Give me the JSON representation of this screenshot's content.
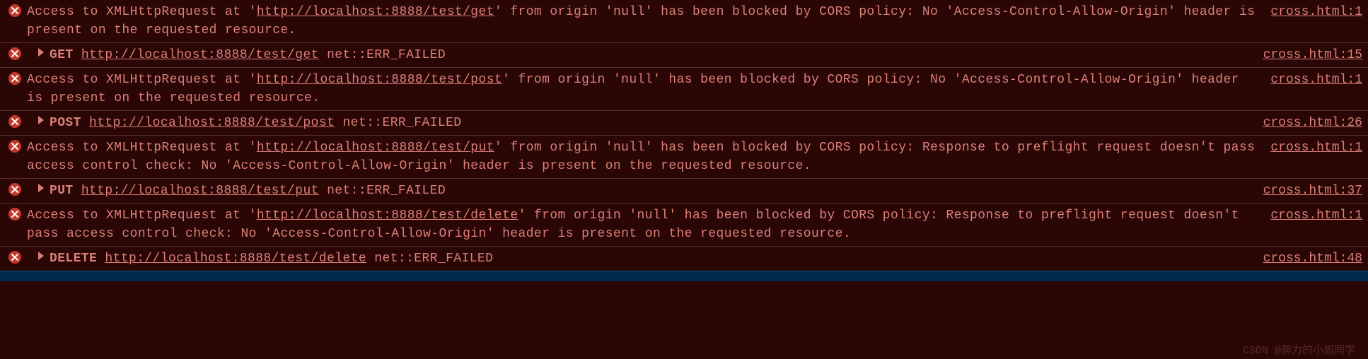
{
  "entries": [
    {
      "type": "cors",
      "expand": false,
      "parts": [
        {
          "t": "Access to XMLHttpRequest at '"
        },
        {
          "t": "http://localhost:8888/test/get",
          "u": true
        },
        {
          "t": "' from origin 'null' has been blocked by CORS policy: No 'Access-Control-Allow-Origin' header is present on the requested resource."
        }
      ],
      "src": "cross.html:1"
    },
    {
      "type": "net",
      "expand": true,
      "parts": [
        {
          "t": "GET ",
          "b": true
        },
        {
          "t": "http://localhost:8888/test/get",
          "u": true
        },
        {
          "t": " net::ERR_FAILED"
        }
      ],
      "src": "cross.html:15"
    },
    {
      "type": "cors",
      "expand": false,
      "parts": [
        {
          "t": "Access to XMLHttpRequest at '"
        },
        {
          "t": "http://localhost:8888/test/post",
          "u": true
        },
        {
          "t": "' from origin 'null' has been blocked by CORS policy: No 'Access-Control-Allow-Origin' header is present on the requested resource."
        }
      ],
      "src": "cross.html:1"
    },
    {
      "type": "net",
      "expand": true,
      "parts": [
        {
          "t": "POST ",
          "b": true
        },
        {
          "t": "http://localhost:8888/test/post",
          "u": true
        },
        {
          "t": " net::ERR_FAILED"
        }
      ],
      "src": "cross.html:26"
    },
    {
      "type": "cors",
      "expand": false,
      "parts": [
        {
          "t": "Access to XMLHttpRequest at '"
        },
        {
          "t": "http://localhost:8888/test/put",
          "u": true
        },
        {
          "t": "' from origin 'null' has been blocked by CORS policy: Response to preflight request doesn't pass access control check: No 'Access-Control-Allow-Origin' header is present on the requested resource."
        }
      ],
      "src": "cross.html:1"
    },
    {
      "type": "net",
      "expand": true,
      "parts": [
        {
          "t": "PUT ",
          "b": true
        },
        {
          "t": "http://localhost:8888/test/put",
          "u": true
        },
        {
          "t": " net::ERR_FAILED"
        }
      ],
      "src": "cross.html:37"
    },
    {
      "type": "cors",
      "expand": false,
      "parts": [
        {
          "t": "Access to XMLHttpRequest at '"
        },
        {
          "t": "http://localhost:8888/test/delete",
          "u": true
        },
        {
          "t": "' from origin 'null' has been blocked by CORS policy: Response to preflight request doesn't pass access control check: No 'Access-Control-Allow-Origin' header is present on the requested resource."
        }
      ],
      "src": "cross.html:1"
    },
    {
      "type": "net",
      "expand": true,
      "parts": [
        {
          "t": "DELETE ",
          "b": true
        },
        {
          "t": "http://localhost:8888/test/delete",
          "u": true
        },
        {
          "t": " net::ERR_FAILED"
        }
      ],
      "src": "cross.html:48"
    }
  ],
  "watermark": "CSDN @努力的小周同学"
}
